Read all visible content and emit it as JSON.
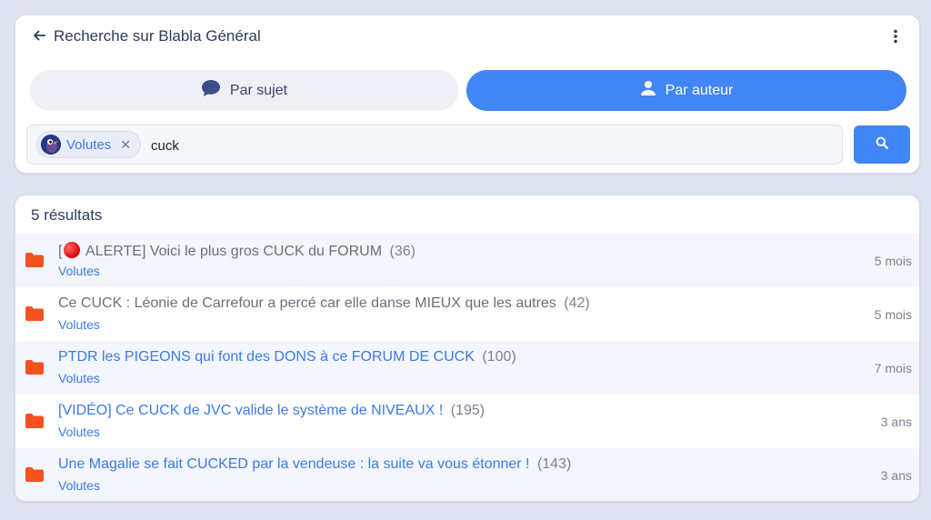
{
  "header": {
    "title": "Recherche sur Blabla Général",
    "back_icon": "arrow-left-icon",
    "more_icon": "more-vertical-icon"
  },
  "mode_toggle": {
    "by_subject": {
      "label": "Par sujet",
      "icon": "chat-bubble-icon",
      "active": false
    },
    "by_author": {
      "label": "Par auteur",
      "icon": "person-icon",
      "active": true
    }
  },
  "search": {
    "author_chip": {
      "label": "Volutes",
      "remove_icon": "close-icon"
    },
    "query": "cuck",
    "submit_icon": "search-icon"
  },
  "results": {
    "count_label": "5 résultats",
    "items": [
      {
        "prefix": "[",
        "has_alert_icon": true,
        "title": " ALERTE] Voici le plus gros CUCK du FORUM",
        "replies": "(36)",
        "author": "Volutes",
        "age": "5 mois",
        "read": true
      },
      {
        "prefix": "",
        "has_alert_icon": false,
        "title": "Ce CUCK : Léonie de Carrefour a percé car elle danse MIEUX que les autres",
        "replies": "(42)",
        "author": "Volutes",
        "age": "5 mois",
        "read": true
      },
      {
        "prefix": "",
        "has_alert_icon": false,
        "title": "PTDR les PIGEONS qui font des DONS à ce FORUM DE CUCK",
        "replies": "(100)",
        "author": "Volutes",
        "age": "7 mois",
        "read": false
      },
      {
        "prefix": "",
        "has_alert_icon": false,
        "title": "[VIDÉO] Ce CUCK de JVC valide le système de NIVEAUX !",
        "replies": "(195)",
        "author": "Volutes",
        "age": "3 ans",
        "read": false
      },
      {
        "prefix": "",
        "has_alert_icon": false,
        "title": "Une Magalie se fait CUCKED par la vendeuse : la suite va vous étonner !",
        "replies": "(143)",
        "author": "Volutes",
        "age": "3 ans",
        "read": false
      }
    ]
  },
  "colors": {
    "accent": "#4285f4",
    "link": "#3d7ae6",
    "folder": "#f4511e",
    "background": "#dfe3ef"
  }
}
